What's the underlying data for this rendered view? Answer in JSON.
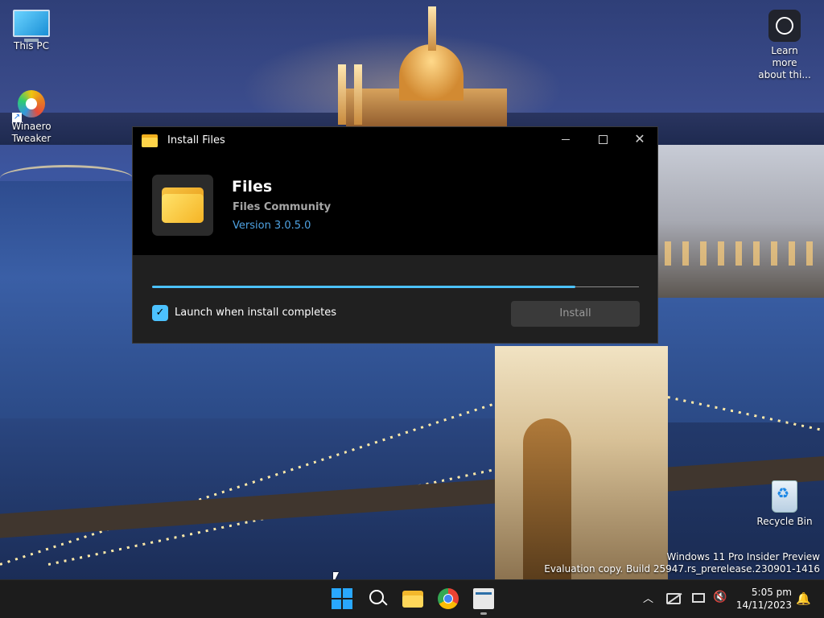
{
  "desktop": {
    "icons": [
      {
        "label": "This PC",
        "icon": "monitor-icon"
      },
      {
        "label": "Winaero Tweaker",
        "icon": "winaero-tweaker-icon"
      },
      {
        "label": "Learn more about thi...",
        "icon": "learn-more-icon"
      },
      {
        "label": "Recycle Bin",
        "icon": "recycle-bin-icon"
      }
    ],
    "watermark": {
      "line1": "Windows 11 Pro Insider Preview",
      "line2": "Evaluation copy. Build 25947.rs_prerelease.230901-1416"
    }
  },
  "installer": {
    "window_title": "Install Files",
    "app_name": "Files",
    "publisher": "Files Community",
    "version": "Version 3.0.5.0",
    "progress": 0.87,
    "launch_checkbox": {
      "label": "Launch when install completes",
      "checked": true
    },
    "install_button": "Install",
    "accent_color": "#4cc2ff"
  },
  "taskbar": {
    "items": [
      "start-icon",
      "search-icon",
      "file-explorer-icon",
      "chrome-icon",
      "app-installer-icon"
    ],
    "tray": {
      "time": "5:05 pm",
      "date": "14/11/2023"
    }
  }
}
